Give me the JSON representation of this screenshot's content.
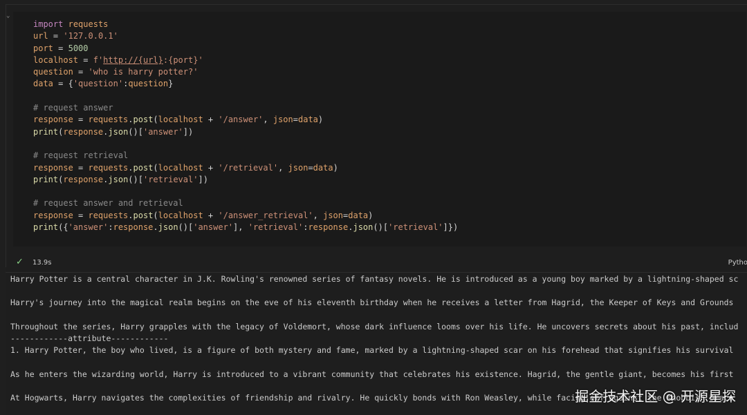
{
  "code_lines": [
    [
      [
        "kw",
        "import"
      ],
      [
        "pl",
        " "
      ],
      [
        "var",
        "requests"
      ]
    ],
    [
      [
        "var",
        "url"
      ],
      [
        "op",
        " = "
      ],
      [
        "str",
        "'127.0.0.1'"
      ]
    ],
    [
      [
        "var",
        "port"
      ],
      [
        "op",
        " = "
      ],
      [
        "num",
        "5000"
      ]
    ],
    [
      [
        "var",
        "localhost"
      ],
      [
        "op",
        " = "
      ],
      [
        "str",
        "f'"
      ],
      [
        "url",
        "http://{url}"
      ],
      [
        "str",
        ":{port}'"
      ]
    ],
    [
      [
        "var",
        "question"
      ],
      [
        "op",
        " = "
      ],
      [
        "str",
        "'who is harry potter?'"
      ]
    ],
    [
      [
        "var",
        "data"
      ],
      [
        "op",
        " = "
      ],
      [
        "pl",
        "{"
      ],
      [
        "str",
        "'question'"
      ],
      [
        "pl",
        ":"
      ],
      [
        "var",
        "question"
      ],
      [
        "pl",
        "}"
      ]
    ],
    [],
    [
      [
        "cm",
        "# request answer"
      ]
    ],
    [
      [
        "var",
        "response"
      ],
      [
        "op",
        " = "
      ],
      [
        "var",
        "requests"
      ],
      [
        "pl",
        "."
      ],
      [
        "fn",
        "post"
      ],
      [
        "pl",
        "("
      ],
      [
        "var",
        "localhost"
      ],
      [
        "op",
        " + "
      ],
      [
        "str",
        "'/answer'"
      ],
      [
        "pl",
        ", "
      ],
      [
        "var",
        "json"
      ],
      [
        "op",
        "="
      ],
      [
        "var",
        "data"
      ],
      [
        "pl",
        ")"
      ]
    ],
    [
      [
        "fn",
        "print"
      ],
      [
        "pl",
        "("
      ],
      [
        "var",
        "response"
      ],
      [
        "pl",
        "."
      ],
      [
        "fn",
        "json"
      ],
      [
        "pl",
        "()["
      ],
      [
        "str",
        "'answer'"
      ],
      [
        "pl",
        "])"
      ]
    ],
    [],
    [
      [
        "cm",
        "# request retrieval"
      ]
    ],
    [
      [
        "var",
        "response"
      ],
      [
        "op",
        " = "
      ],
      [
        "var",
        "requests"
      ],
      [
        "pl",
        "."
      ],
      [
        "fn",
        "post"
      ],
      [
        "pl",
        "("
      ],
      [
        "var",
        "localhost"
      ],
      [
        "op",
        " + "
      ],
      [
        "str",
        "'/retrieval'"
      ],
      [
        "pl",
        ", "
      ],
      [
        "var",
        "json"
      ],
      [
        "op",
        "="
      ],
      [
        "var",
        "data"
      ],
      [
        "pl",
        ")"
      ]
    ],
    [
      [
        "fn",
        "print"
      ],
      [
        "pl",
        "("
      ],
      [
        "var",
        "response"
      ],
      [
        "pl",
        "."
      ],
      [
        "fn",
        "json"
      ],
      [
        "pl",
        "()["
      ],
      [
        "str",
        "'retrieval'"
      ],
      [
        "pl",
        "])"
      ]
    ],
    [],
    [
      [
        "cm",
        "# request answer and retrieval"
      ]
    ],
    [
      [
        "var",
        "response"
      ],
      [
        "op",
        " = "
      ],
      [
        "var",
        "requests"
      ],
      [
        "pl",
        "."
      ],
      [
        "fn",
        "post"
      ],
      [
        "pl",
        "("
      ],
      [
        "var",
        "localhost"
      ],
      [
        "op",
        " + "
      ],
      [
        "str",
        "'/answer_retrieval'"
      ],
      [
        "pl",
        ", "
      ],
      [
        "var",
        "json"
      ],
      [
        "op",
        "="
      ],
      [
        "var",
        "data"
      ],
      [
        "pl",
        ")"
      ]
    ],
    [
      [
        "fn",
        "print"
      ],
      [
        "pl",
        "({"
      ],
      [
        "str",
        "'answer'"
      ],
      [
        "pl",
        ":"
      ],
      [
        "var",
        "response"
      ],
      [
        "pl",
        "."
      ],
      [
        "fn",
        "json"
      ],
      [
        "pl",
        "()["
      ],
      [
        "str",
        "'answer'"
      ],
      [
        "pl",
        "], "
      ],
      [
        "str",
        "'retrieval'"
      ],
      [
        "pl",
        ":"
      ],
      [
        "var",
        "response"
      ],
      [
        "pl",
        "."
      ],
      [
        "fn",
        "json"
      ],
      [
        "pl",
        "()["
      ],
      [
        "str",
        "'retrieval'"
      ],
      [
        "pl",
        "]})"
      ]
    ]
  ],
  "status": {
    "check_icon": "check-icon",
    "time": "13.9s",
    "language": "Pytho"
  },
  "output_lines": [
    "Harry Potter is a central character in J.K. Rowling's renowned series of fantasy novels. He is introduced as a young boy marked by a lightning-shaped sc",
    "",
    "Harry's journey into the magical realm begins on the eve of his eleventh birthday when he receives a letter from Hagrid, the Keeper of Keys and Grounds",
    "",
    "Throughout the series, Harry grapples with the legacy of Voldemort, whose dark influence looms over his life. He uncovers secrets about his past, includ",
    "------------attribute------------",
    "1. Harry Potter, the boy who lived, is a figure of both mystery and fame, marked by a lightning-shaped scar on his forehead that signifies his survival",
    "",
    "As he enters the wizarding world, Harry is introduced to a vibrant community that celebrates his existence. Hagrid, the gentle giant, becomes his first",
    "",
    "At Hogwarts, Harry navigates the complexities of friendship and rivalry. He quickly bonds with Ron Weasley, while facing off against the snobbish Draco"
  ],
  "watermark": "掘金技术社区 @ 开源星探"
}
